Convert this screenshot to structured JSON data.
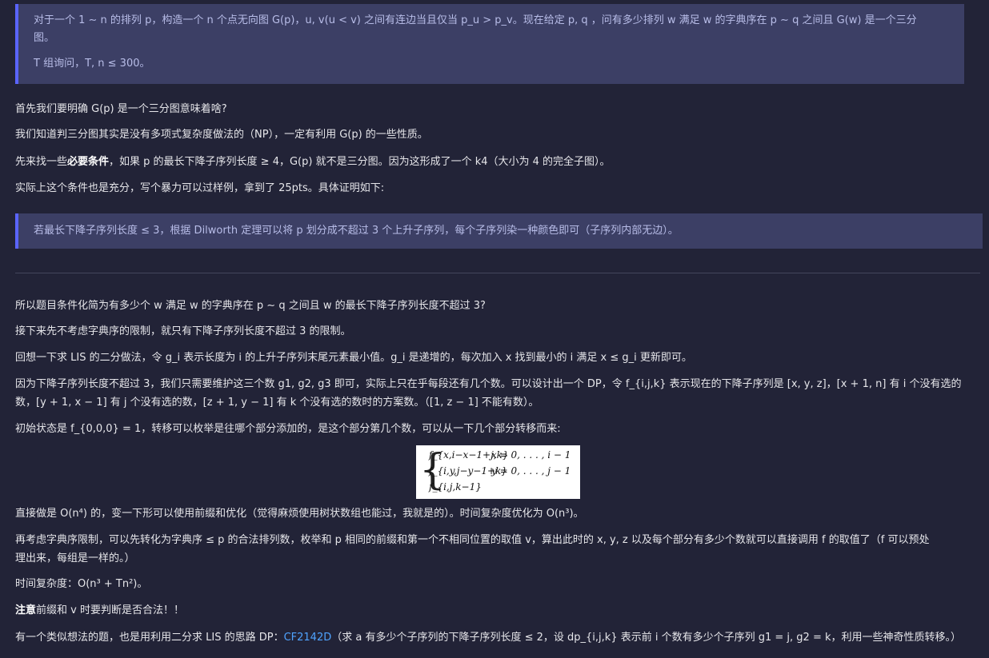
{
  "callout1": {
    "line1": "对于一个 1 ∼ n 的排列 p，构造一个 n 个点无向图 G(p)，u, v(u < v) 之间有连边当且仅当 p_u > p_v。现在给定 p, q ，问有多少排列 w 满足 w 的字典序在 p ∼ q 之间且 G(w) 是一个三分",
    "line2": "图。",
    "line3": "T 组询问，T, n ≤ 300。"
  },
  "paragraphs": {
    "p1": "首先我们要明确 G(p) 是一个三分图意味着啥?",
    "p2": "我们知道判三分图其实是没有多项式复杂度做法的（NP），一定有利用 G(p) 的一些性质。",
    "p3_a": "先来找一些",
    "p3_bold": "必要条件",
    "p3_b": "，如果 p 的最长下降子序列长度 ≥ 4，G(p) 就不是三分图。因为这形成了一个 k4（大小为 4 的完全子图）。",
    "p4": "实际上这个条件也是充分，写个暴力可以过样例，拿到了 25pts。具体证明如下:"
  },
  "callout2": {
    "text": "若最长下降子序列长度 ≤ 3，根据 Dilworth 定理可以将 p 划分成不超过 3 个上升子序列，每个子序列染一种颜色即可（子序列内部无边）。"
  },
  "section2": {
    "p5": "所以题目条件化简为有多少个 w 满足 w 的字典序在 p ∼ q 之间且 w 的最长下降子序列长度不超过 3?",
    "p6": "接下来先不考虑字典序的限制，就只有下降子序列长度不超过 3 的限制。",
    "p7": "回想一下求 LIS 的二分做法，令 g_i 表示长度为 i 的上升子序列末尾元素最小值。g_i 是递增的，每次加入 x 找到最小的 i 满足 x ≤ g_i 更新即可。",
    "p8_line1": "因为下降子序列长度不超过 3，我们只需要维护这三个数 g1, g2, g3 即可，实际上只在乎每段还有几个数。可以设计出一个 DP，令 f_{i,j,k} 表示现在的下降子序列是 [x, y, z]，[x + 1, n] 有 i 个没有选的",
    "p8_line2": "数，[y + 1, x − 1] 有 j 个没有选的数，[z + 1, y − 1] 有 k 个没有选的数时的方案数。（[1, z − 1] 不能有数）。",
    "p9": "初始状态是 f_{0,0,0} = 1，转移可以枚举是往哪个部分添加的，是这个部分第几个数，可以从一下几个部分转移而来:",
    "formula": {
      "row1_term": "f_{x,i−x−1+j,k}",
      "row1_cond": "x = 0, . . . , i − 1",
      "row2_term": "f_{i,y,j−y−1+k}",
      "row2_cond": "y = 0, . . . , j − 1",
      "row3_term": "f_{i,j,k−1}"
    },
    "p10": "直接做是 O(n⁴) 的，变一下形可以使用前缀和优化（觉得麻烦使用树状数组也能过，我就是的）。时间复杂度优化为 O(n³)。",
    "p11_line1": "再考虑字典序限制，可以先转化为字典序 ≤ p 的合法排列数，枚举和 p 相同的前缀和第一个不相同位置的取值 v，算出此时的 x, y, z 以及每个部分有多少个数就可以直接调用 f 的取值了（f 可以预处",
    "p11_line2": "理出来，每组是一样的。）",
    "p12": "时间复杂度：O(n³ + Tn²)。",
    "p13_bold": "注意",
    "p13_rest": "前缀和 v 时要判断是否合法！！",
    "p14_a": "有一个类似想法的题，也是用利用二分求 LIS 的思路 DP：",
    "p14_link": "CF2142D",
    "p14_b": "（求 a 有多少个子序列的下降子序列长度 ≤ 2，设 dp_{i,j,k} 表示前 i 个数有多少个子序列 g1 = j, g2 = k，利用一些神奇性质转移。）"
  }
}
